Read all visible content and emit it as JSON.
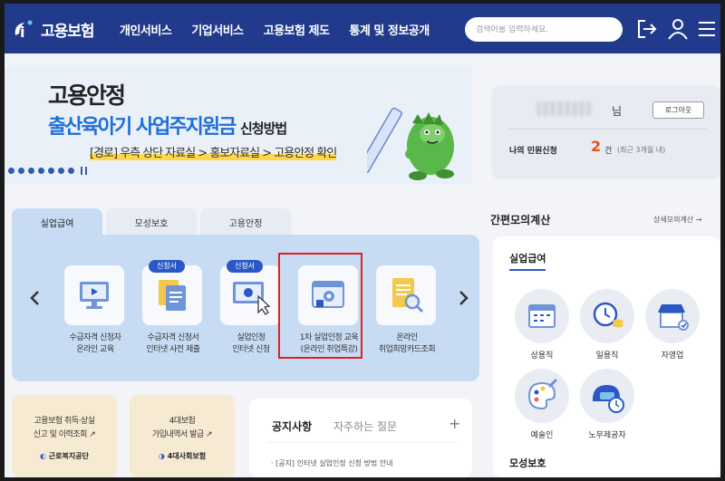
{
  "header": {
    "logo_text": "고용보험",
    "nav": [
      "개인서비스",
      "기업서비스",
      "고용보험 제도",
      "통계 및 정보공개"
    ],
    "search_placeholder": "검색어를 입력하세요.",
    "icons": [
      "logout-icon",
      "user-icon",
      "menu-icon"
    ]
  },
  "banner": {
    "title": "고용안정",
    "subtitle": "출산육아기 사업주지원금",
    "subtitle_suffix": "신청방법",
    "path": "[경로] 우측 상단 자료실 > 홍보자료실 > 고용안정 확인",
    "slide_count": 7
  },
  "user": {
    "name_suffix": "님",
    "logout_label": "로그아웃",
    "civil_label": "나의 민원신청",
    "civil_count": "2",
    "civil_unit": "건",
    "civil_recent": "(최근 3개월 내)"
  },
  "tabs": [
    "실업급여",
    "모성보호",
    "고용안정"
  ],
  "services": [
    {
      "label": "수급자격 신청자\n온라인 교육",
      "badge": ""
    },
    {
      "label": "수급자격 신청서\n인터넷 사전 제출",
      "badge": "신청서"
    },
    {
      "label": "실업인정\n인터넷 신청",
      "badge": "신청서"
    },
    {
      "label": "1차 실업인정 교육\n(온라인 취업특강)",
      "badge": ""
    },
    {
      "label": "온라인\n취업희망카드조회",
      "badge": ""
    }
  ],
  "insurance_cards": [
    {
      "text": "고용보험 취득·상실\n신고 및 이력조회 ↗",
      "org": "근로복지공단"
    },
    {
      "text": "4대보험\n가입내역서 발급 ↗",
      "org": "4대사회보험"
    }
  ],
  "notice": {
    "tab_active": "공지사항",
    "tab_other": "자주하는 질문",
    "item": "[공지] 인터넷 실업인정 신청 방법 안내"
  },
  "simulation": {
    "title": "간편모의계산",
    "link": "상세모의계산 →",
    "section": "실업급여",
    "items": [
      "상용직",
      "일용직",
      "자영업",
      "예술인",
      "노무제공자"
    ],
    "section2": "모성보호"
  },
  "colors": {
    "header": "#223a8c",
    "accent": "#2c58c6",
    "panel": "#c7dcf3",
    "highlight": "#e02020"
  }
}
